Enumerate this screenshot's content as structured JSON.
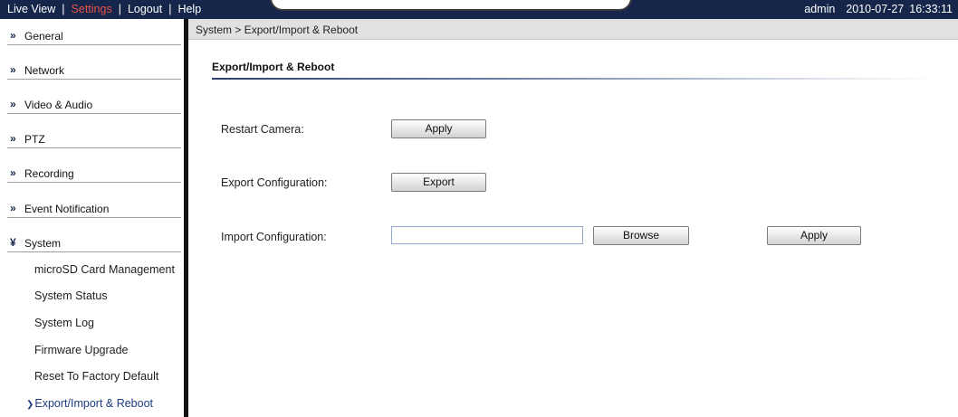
{
  "topbar": {
    "nav": [
      "Live View",
      "Settings",
      "Logout",
      "Help"
    ],
    "separator": "|",
    "user": "admin",
    "date": "2010-07-27",
    "time": "16:33:11",
    "active_color": "#e8534a",
    "background": "#15264a"
  },
  "sidebar": {
    "sections": [
      {
        "icon": "double-chevron-right-icon",
        "glyph": "»",
        "label": "General"
      },
      {
        "icon": "double-chevron-right-icon",
        "glyph": "»",
        "label": "Network"
      },
      {
        "icon": "double-chevron-right-icon",
        "glyph": "»",
        "label": "Video & Audio"
      },
      {
        "icon": "double-chevron-right-icon",
        "glyph": "»",
        "label": "PTZ"
      },
      {
        "icon": "double-chevron-right-icon",
        "glyph": "»",
        "label": "Recording"
      },
      {
        "icon": "double-chevron-right-icon",
        "glyph": "»",
        "label": "Event Notification"
      },
      {
        "icon": "double-chevron-down-icon",
        "glyph": "¥",
        "label": "System"
      }
    ],
    "system_items": [
      "microSD Card Management",
      "System Status",
      "System Log",
      "Firmware Upgrade",
      "Reset To Factory Default",
      "Export/Import & Reboot"
    ],
    "current_item_icon": "chevron-right-icon",
    "current_item_glyph": "❯"
  },
  "main": {
    "breadcrumb": "System > Export/Import & Reboot",
    "title": "Export/Import & Reboot",
    "rows": {
      "restart": {
        "label": "Restart Camera:",
        "button": "Apply"
      },
      "export": {
        "label": "Export Configuration:",
        "button": "Export"
      },
      "import": {
        "label": "Import Configuration:",
        "value": "",
        "browse": "Browse",
        "button": "Apply"
      }
    }
  }
}
